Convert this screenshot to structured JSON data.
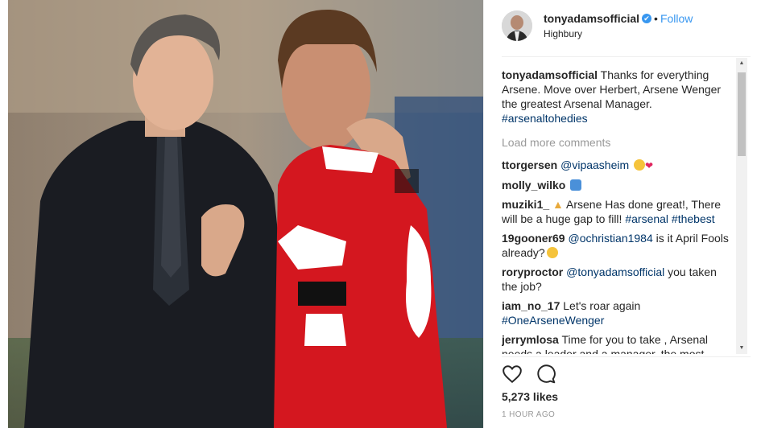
{
  "header": {
    "username": "tonyadamsofficial",
    "verified_glyph": "✔",
    "separator": "•",
    "follow_label": "Follow",
    "location": "Highbury"
  },
  "caption": {
    "username": "tonyadamsofficial",
    "text": "Thanks for everything Arsene. Move over Herbert, Arsene Wenger the greatest Arsenal Manager.",
    "hashtag": "#arsenaltohedies"
  },
  "load_more_label": "Load more comments",
  "comments": [
    {
      "user": "ttorgersen",
      "mention": "@vipaasheim"
    },
    {
      "user": "molly_wilko"
    },
    {
      "user": "muziki1_",
      "text": "Arsene Has done great!, There will be a huge gap to fill!",
      "tags": [
        "#arsenal",
        "#thebest"
      ]
    },
    {
      "user": "19gooner69",
      "mention": "@ochristian1984",
      "text": "is it April Fools already?"
    },
    {
      "user": "roryproctor",
      "mention": "@tonyadamsofficial",
      "text": "you taken the job?"
    },
    {
      "user": "iam_no_17",
      "text": "Let's roar again",
      "tag": "#OneArseneWenger"
    },
    {
      "user": "jerrymlosa",
      "text": "Time for you to take , Arsenal needs a leader and a manager, the most urgent"
    }
  ],
  "likes": "5,273 likes",
  "timestamp": "1 HOUR AGO",
  "icons": {
    "like": "heart-icon",
    "comment": "comment-bubble-icon",
    "scroll_up": "triangle-up",
    "scroll_down": "triangle-down"
  },
  "colors": {
    "link": "#003569",
    "follow": "#3897f0",
    "muted": "#999999",
    "text": "#262626",
    "arsenal_red": "#d4171f"
  }
}
